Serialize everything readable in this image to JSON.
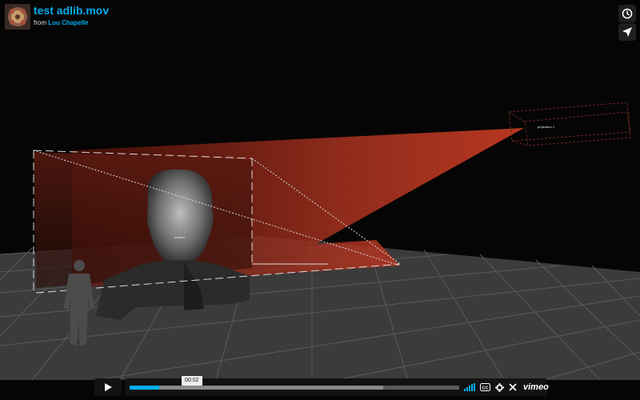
{
  "video": {
    "title": "test adlib.mov",
    "byline_prefix": "from",
    "author": "Lou Chapelle",
    "scene_labels": {
      "left_box": "secteur",
      "right_box": "projecteur 1"
    }
  },
  "side_actions": [
    {
      "icon": "clock-icon"
    },
    {
      "icon": "send-icon"
    }
  ],
  "controls": {
    "play_icon": "play-icon",
    "timecode": "00:02",
    "progress_fraction": 0.09,
    "loaded_fraction": 0.77,
    "brand": "vimeo",
    "icons": [
      "volume-icon",
      "cc-icon",
      "settings-icon",
      "fullscreen-icon"
    ]
  },
  "colors": {
    "accent": "#00adef",
    "projection": "#b3361f"
  }
}
